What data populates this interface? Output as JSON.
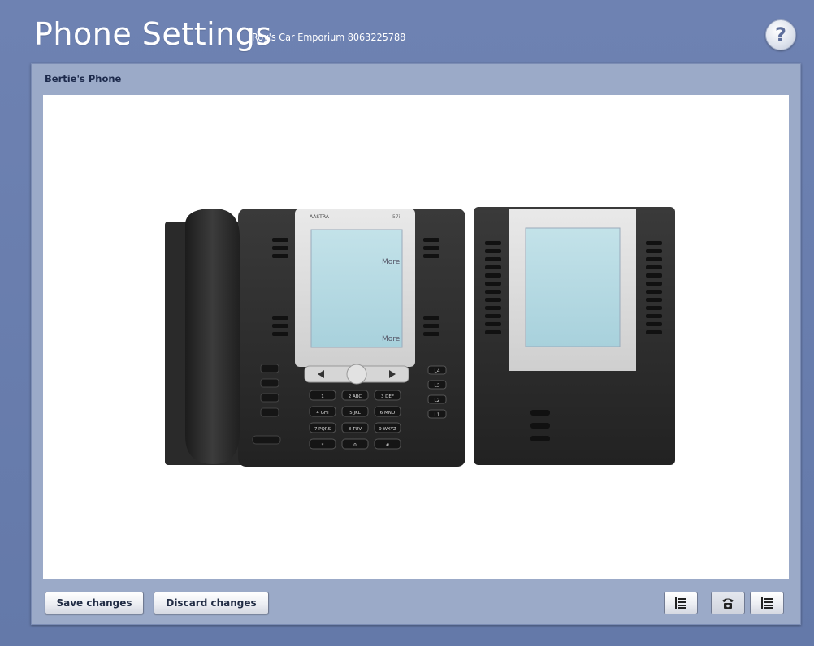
{
  "header": {
    "title": "Phone Settings",
    "subtitle": "Roy's Car Emporium 8063225788",
    "help_label": "?"
  },
  "panel": {
    "title": "Bertie's Phone"
  },
  "phone": {
    "brand": "AASTRA",
    "model": "57i",
    "screen_more_top": "More",
    "screen_more_bottom": "More",
    "line_keys": [
      "L4",
      "L3",
      "L2",
      "L1"
    ],
    "keypad": [
      "1",
      "2 ABC",
      "3 DEF",
      "4 GHI",
      "5 JKL",
      "6 MNO",
      "7 PQRS",
      "8 TUV",
      "9 WXYZ",
      "*",
      "0",
      "#"
    ]
  },
  "toolbar": {
    "save_label": "Save changes",
    "discard_label": "Discard changes"
  },
  "colors": {
    "background": "#6b7fae",
    "panel": "#9baac8",
    "phone_body": "#2b2b2b",
    "screen": "#b7dbe3"
  },
  "icons": {
    "view_list_1": "list-icon",
    "view_phone": "phone-icon",
    "view_list_2": "list-icon"
  }
}
